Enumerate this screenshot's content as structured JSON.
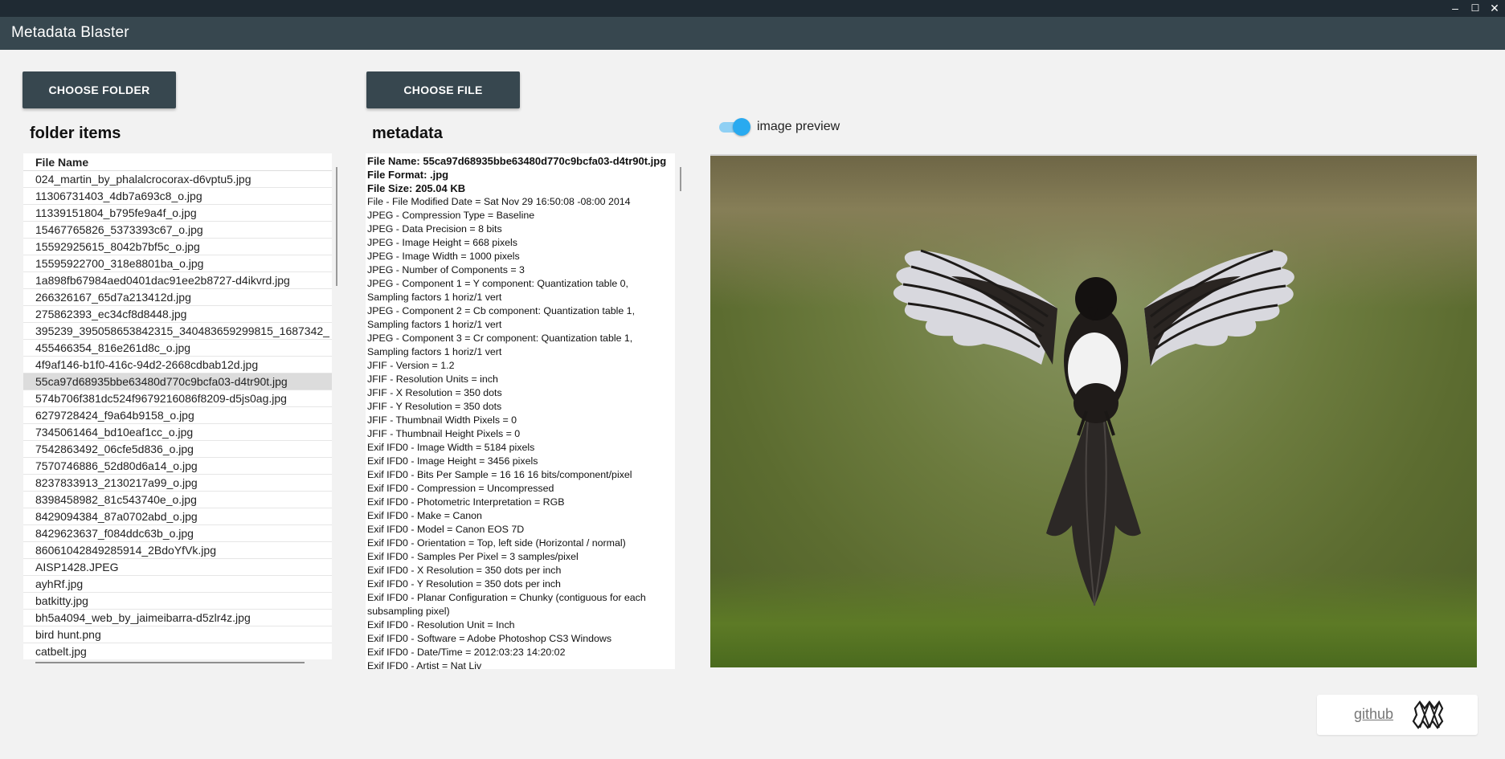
{
  "app": {
    "title": "Metadata Blaster",
    "window_controls": [
      "–",
      "☐",
      "✕"
    ]
  },
  "buttons": {
    "choose_folder": "CHOOSE FOLDER",
    "choose_file": "CHOOSE FILE"
  },
  "folder": {
    "title": "folder items",
    "column_header": "File Name",
    "selected_index": 12,
    "items": [
      "024_martin_by_phalalcrocorax-d6vptu5.jpg",
      "11306731403_4db7a693c8_o.jpg",
      "11339151804_b795fe9a4f_o.jpg",
      "15467765826_5373393c67_o.jpg",
      "15592925615_8042b7bf5c_o.jpg",
      "15595922700_318e8801ba_o.jpg",
      "1a898fb67984aed0401dac91ee2b8727-d4ikvrd.jpg",
      "266326167_65d7a213412d.jpg",
      "275862393_ec34cf8d8448.jpg",
      "395239_395058653842315_340483659299815_1687342_",
      "455466354_816e261d8c_o.jpg",
      "4f9af146-b1f0-416c-94d2-2668cdbab12d.jpg",
      "55ca97d68935bbe63480d770c9bcfa03-d4tr90t.jpg",
      "574b706f381dc524f9679216086f8209-d5js0ag.jpg",
      "6279728424_f9a64b9158_o.jpg",
      "7345061464_bd10eaf1cc_o.jpg",
      "7542863492_06cfe5d836_o.jpg",
      "7570746886_52d80d6a14_o.jpg",
      "8237833913_2130217a99_o.jpg",
      "8398458982_81c543740e_o.jpg",
      "8429094384_87a0702abd_o.jpg",
      "8429623637_f084ddc63b_o.jpg",
      "86061042849285914_2BdoYfVk.jpg",
      "AISP1428.JPEG",
      "ayhRf.jpg",
      "batkitty.jpg",
      "bh5a4094_web_by_jaimeibarra-d5zlr4z.jpg",
      "bird hunt.png",
      "catbelt.jpg"
    ]
  },
  "metadata": {
    "title": "metadata",
    "header_lines": [
      "File Name: 55ca97d68935bbe63480d770c9bcfa03-d4tr90t.jpg",
      "File Format: .jpg",
      "File Size: 205.04 KB"
    ],
    "lines": [
      "File - File Modified Date = Sat Nov 29 16:50:08 -08:00 2014",
      "JPEG - Compression Type = Baseline",
      "JPEG - Data Precision = 8 bits",
      "JPEG - Image Height = 668 pixels",
      "JPEG - Image Width = 1000 pixels",
      "JPEG - Number of Components = 3",
      "JPEG - Component 1 = Y component: Quantization table 0,\nSampling factors 1 horiz/1 vert",
      "JPEG - Component 2 = Cb component: Quantization table 1,\nSampling factors 1 horiz/1 vert",
      "JPEG - Component 3 = Cr component: Quantization table 1,\nSampling factors 1 horiz/1 vert",
      "JFIF - Version = 1.2",
      "JFIF - Resolution Units = inch",
      "JFIF - X Resolution = 350 dots",
      "JFIF - Y Resolution = 350 dots",
      "JFIF - Thumbnail Width Pixels = 0",
      "JFIF - Thumbnail Height Pixels = 0",
      "Exif IFD0 - Image Width = 5184 pixels",
      "Exif IFD0 - Image Height = 3456 pixels",
      "Exif IFD0 - Bits Per Sample = 16 16 16 bits/component/pixel",
      "Exif IFD0 - Compression = Uncompressed",
      "Exif IFD0 - Photometric Interpretation = RGB",
      "Exif IFD0 - Make = Canon",
      "Exif IFD0 - Model = Canon EOS 7D",
      "Exif IFD0 - Orientation = Top, left side (Horizontal / normal)",
      "Exif IFD0 - Samples Per Pixel = 3 samples/pixel",
      "Exif IFD0 - X Resolution = 350 dots per inch",
      "Exif IFD0 - Y Resolution = 350 dots per inch",
      "Exif IFD0 - Planar Configuration = Chunky (contiguous for each\nsubsampling pixel)",
      "Exif IFD0 - Resolution Unit = Inch",
      "Exif IFD0 - Software = Adobe Photoshop CS3 Windows",
      "Exif IFD0 - Date/Time = 2012:03:23 14:20:02",
      "Exif IFD0 - Artist = Nat Liv"
    ]
  },
  "preview": {
    "toggle_label": "image preview",
    "toggle_on": true,
    "toggle_color": "#29aaf0"
  },
  "footer": {
    "github_label": "github",
    "logo_icon": "mosaic-diamond-logo"
  },
  "colors": {
    "appbar": "#37474f",
    "os_bar": "#1f2a33",
    "button": "#37474f",
    "background": "#f2f2f2"
  }
}
